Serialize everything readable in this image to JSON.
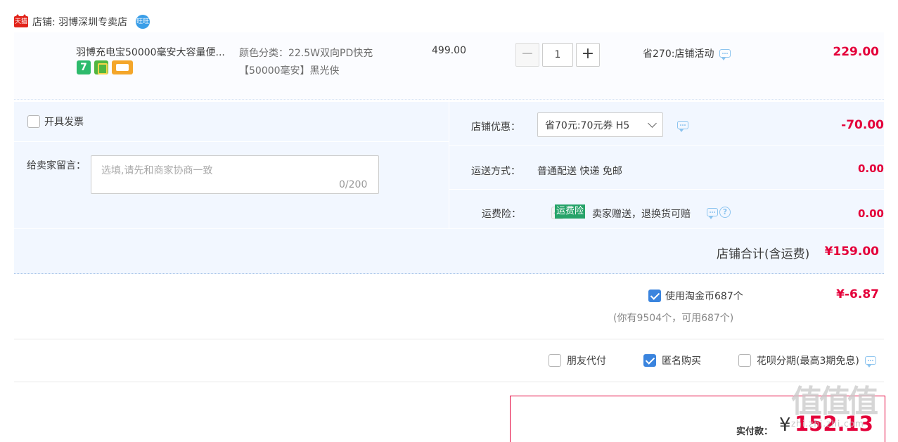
{
  "store": {
    "badge": "天猫",
    "label": "店铺: 羽博深圳专卖店",
    "ww_icon": "旺旺"
  },
  "item": {
    "title": "羽博充电宝50000毫安大容量便...",
    "sku_line1": "颜色分类：22.5W双向PD快充",
    "sku_line2": "【50000毫安】黑光侠",
    "price": "499.00",
    "qty_minus": "−",
    "qty": "1",
    "qty_plus": "+",
    "promo": "省270:店铺活动",
    "total": "229.00",
    "tag_7": "7"
  },
  "options": {
    "invoice": "开具发票",
    "msg_label": "给卖家留言：",
    "msg_placeholder": "选填,请先和商家协商一致",
    "msg_count": "0/200",
    "discount_label": "店铺优惠：",
    "discount_value": "省70元:70元券 H5",
    "discount_amount": "-70.00",
    "ship_label": "运送方式：",
    "ship_value": "普通配送 快递 免邮",
    "ship_amount": "0.00",
    "ins_label": "运费险：",
    "ins_tag": "运费险",
    "ins_text": "卖家赠送，退换货可赔",
    "ins_help": "?",
    "ins_amount": "0.00",
    "store_total_label": "店铺合计(含运费)",
    "store_total_value": "¥159.00"
  },
  "coins": {
    "label": "使用淘金币687个",
    "sub": "(你有9504个，可用687个)",
    "value": "¥-6.87"
  },
  "pay_options": {
    "friend": "朋友代付",
    "anon": "匿名购买",
    "huabei": "花呗分期(最高3期免息)"
  },
  "pay": {
    "label": "实付款：",
    "yen": "¥",
    "amount": "152.13"
  },
  "watermark": {
    "big": "值值值",
    "small": "zhi.zhi.zhi.com"
  }
}
